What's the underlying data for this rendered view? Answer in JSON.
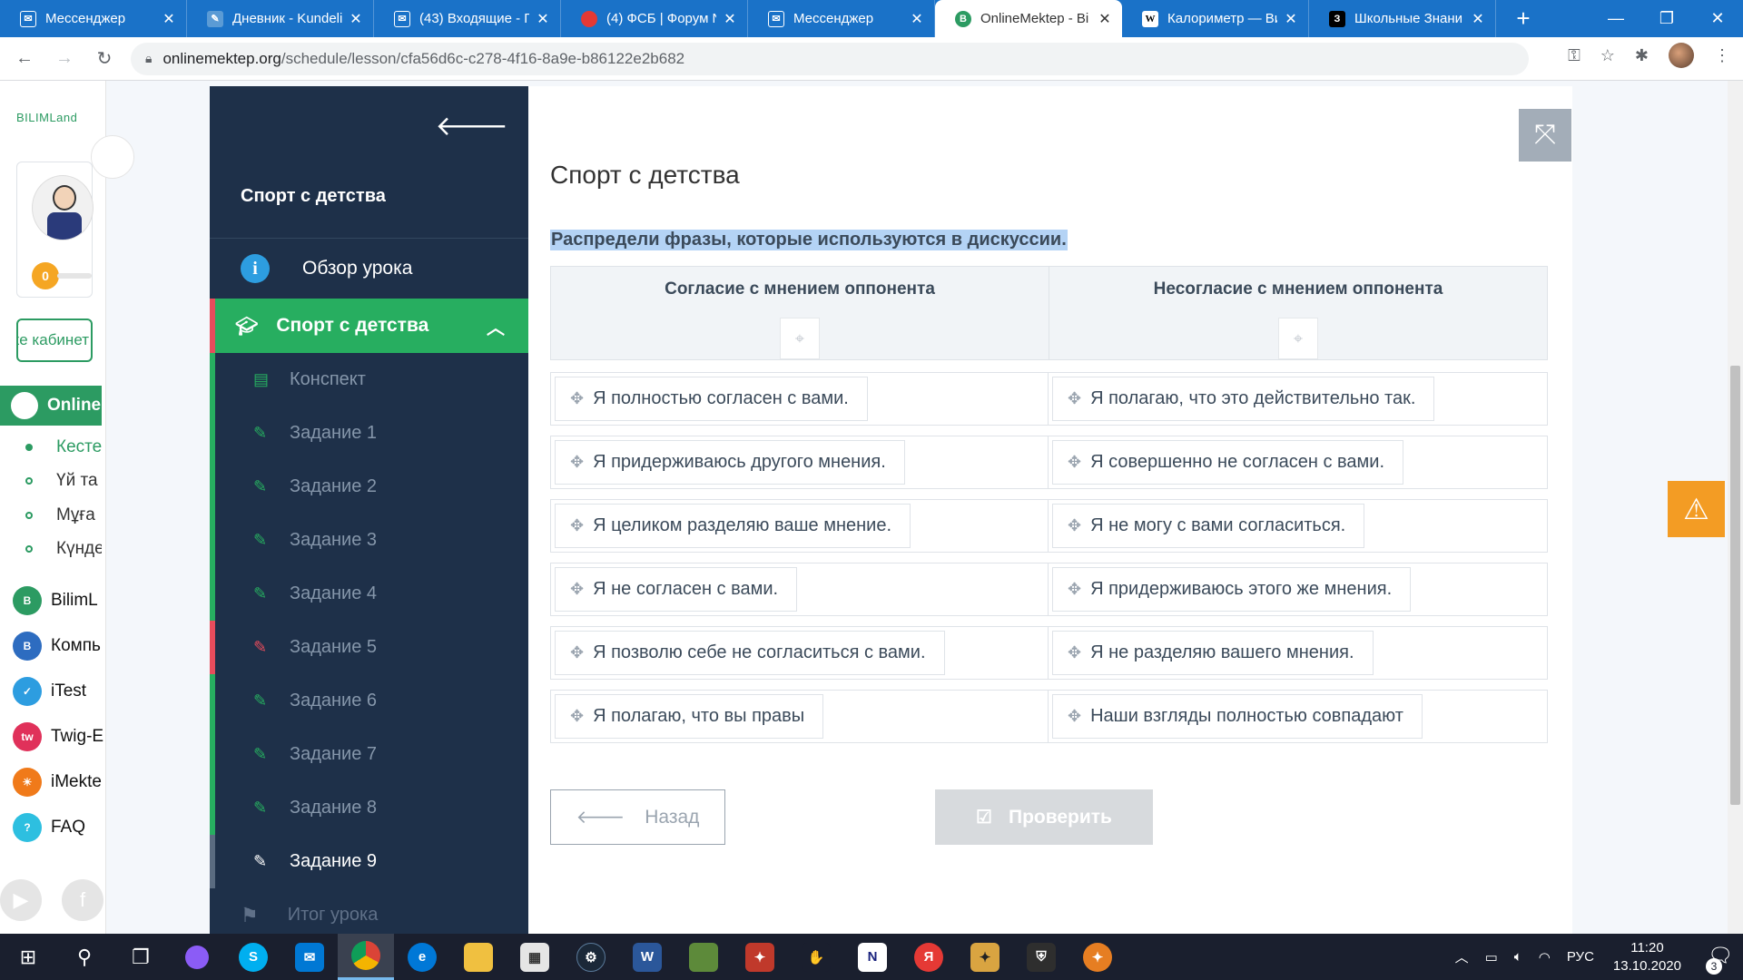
{
  "browser": {
    "tabs": [
      {
        "title": "Мессенджер",
        "favicon": "messenger-icon",
        "color": "#1a72c8"
      },
      {
        "title": "Дневник - Kundelik",
        "favicon": "kundelik-icon",
        "color": "#5b9bd5"
      },
      {
        "title": "(43) Входящие - П",
        "favicon": "mail-icon",
        "color": "#1a72c8"
      },
      {
        "title": "(4) ФСБ | Форум N",
        "favicon": "forum-icon",
        "color": "#e53935"
      },
      {
        "title": "Мессенджер",
        "favicon": "messenger-icon",
        "color": "#1a72c8"
      },
      {
        "title": "OnlineMektep - Bi",
        "favicon": "onlinemektep-icon",
        "color": "#2c9b62",
        "active": true
      },
      {
        "title": "Калориметр — Ви",
        "favicon": "wikipedia-icon",
        "color": "#ffffff"
      },
      {
        "title": "Школьные Знани",
        "favicon": "znanija-icon",
        "color": "#000000"
      }
    ],
    "url_host": "onlinemektep.org",
    "url_path": "/schedule/lesson/cfa56d6c-c278-4f16-8a9e-b86122e2b682"
  },
  "rail": {
    "logo": "BILIMLand",
    "score": "0",
    "cabinet_label": "еке кабинет",
    "online_label": "Online",
    "sub_items": [
      "Кесте",
      "Үй та",
      "Мұға",
      "Күнде"
    ],
    "apps": [
      {
        "label": "BilimL",
        "color": "#2c9b62"
      },
      {
        "label": "Компь",
        "color": "#2d6cc0"
      },
      {
        "label": "iTest",
        "color": "#2d9de0"
      },
      {
        "label": "Twig-E",
        "color": "#e0315a"
      },
      {
        "label": "iMekte",
        "color": "#f07a1a"
      },
      {
        "label": "FAQ",
        "color": "#2dbfe0"
      }
    ]
  },
  "lesson_nav": {
    "title": "Спорт с детства",
    "overview": "Обзор урока",
    "section": "Спорт с детства",
    "items": [
      {
        "label": "Конспект",
        "status": "plain"
      },
      {
        "label": "Задание 1",
        "status": "green"
      },
      {
        "label": "Задание 2",
        "status": "green"
      },
      {
        "label": "Задание 3",
        "status": "green"
      },
      {
        "label": "Задание 4",
        "status": "green"
      },
      {
        "label": "Задание 5",
        "status": "red"
      },
      {
        "label": "Задание 6",
        "status": "green"
      },
      {
        "label": "Задание 7",
        "status": "green"
      },
      {
        "label": "Задание 8",
        "status": "green"
      },
      {
        "label": "Задание 9",
        "status": "current"
      }
    ],
    "summary": "Итог урока"
  },
  "main": {
    "title": "Спорт с детства",
    "instruction": "Распредели фразы, которые используются в дискуссии.",
    "columns": [
      "Согласие с мнением оппонента",
      "Несогласие с мнением оппонента"
    ],
    "rows": [
      [
        "Я полностью согласен с вами.",
        "Я полагаю, что это действительно так."
      ],
      [
        "Я придерживаюсь другого мнения.",
        "Я совершенно не согласен с вами."
      ],
      [
        "Я целиком разделяю ваше мнение.",
        "Я не могу с вами согласиться."
      ],
      [
        "Я не согласен с вами.",
        "Я придерживаюсь этого же мнения."
      ],
      [
        "Я позволю себе не согласиться с вами.",
        "Я не разделяю вашего мнения."
      ],
      [
        "Я полагаю, что вы правы",
        "Наши взгляды полностью совпадают"
      ]
    ],
    "back_label": "Назад",
    "check_label": "Проверить"
  },
  "taskbar": {
    "language": "РУС",
    "time": "11:20",
    "date": "13.10.2020",
    "notifications": "3"
  },
  "colors": {
    "accent_green": "#27ae60",
    "nav_bg": "#1e3049",
    "error_red": "#e74c5c",
    "warning_orange": "#f39c24"
  }
}
